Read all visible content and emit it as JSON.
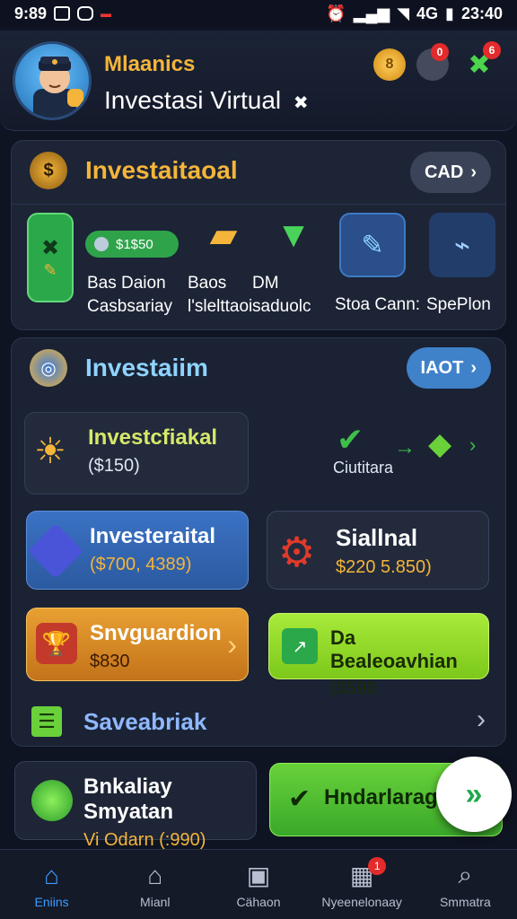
{
  "status_bar": {
    "time": "9:89",
    "right_time": "23:40",
    "signal_text": "4G"
  },
  "header": {
    "app_name": "Mlaanics",
    "subtitle": "Investasi Virtual",
    "subtitle_close": "✖",
    "coin_badge": "8",
    "bell_badge": "0",
    "x_badge": "6"
  },
  "section1": {
    "title": "Investaitaoal",
    "button_label": "CAD",
    "toggle_label": "$1$50",
    "tools": [
      {
        "label": "Bas Daion\nCasbsariay",
        "icon": "wallet-icon"
      },
      {
        "label": "Baos\nl'slelttaoi",
        "icon": "folder-icon"
      },
      {
        "label": "DM\nsaduolc",
        "icon": "gem-icon"
      },
      {
        "label": "Stoa Cann:",
        "icon": "edit-icon"
      },
      {
        "label": "SpePlon",
        "icon": "pipe-icon"
      }
    ]
  },
  "section2": {
    "title": "Investaiim",
    "button_label": "IAOT",
    "card1": {
      "title": "Investcfiakal",
      "value": "($150)"
    },
    "status": "Ciutitara",
    "card2": {
      "title": "Investeraital",
      "value": "($700, 4389)"
    },
    "card3": {
      "title": "Siallnal",
      "value": "$220 5.850)"
    },
    "card4": {
      "title": "Snvguardion",
      "value": "$830"
    },
    "card5": {
      "title": "Da Bealeoavhian",
      "value": "($590"
    },
    "row_title": "Saveabriak"
  },
  "bottom_cards": {
    "left": {
      "title": "Bnkaliay Smyatan",
      "value": "Vi Odarn (:990)"
    },
    "right": {
      "title": "Hndarlarag"
    }
  },
  "nav": [
    {
      "label": "Eniins",
      "icon": "home-icon"
    },
    {
      "label": "Mianl",
      "icon": "bank-icon"
    },
    {
      "label": "Cähaon",
      "icon": "video-icon"
    },
    {
      "label": "Nyeenelonaay",
      "icon": "gift-icon",
      "badge": "1"
    },
    {
      "label": "Smmatra",
      "icon": "search-icon"
    }
  ],
  "colors": {
    "accent_blue": "#3a9cff",
    "accent_orange": "#f4b53a",
    "accent_green": "#6ad13a"
  }
}
